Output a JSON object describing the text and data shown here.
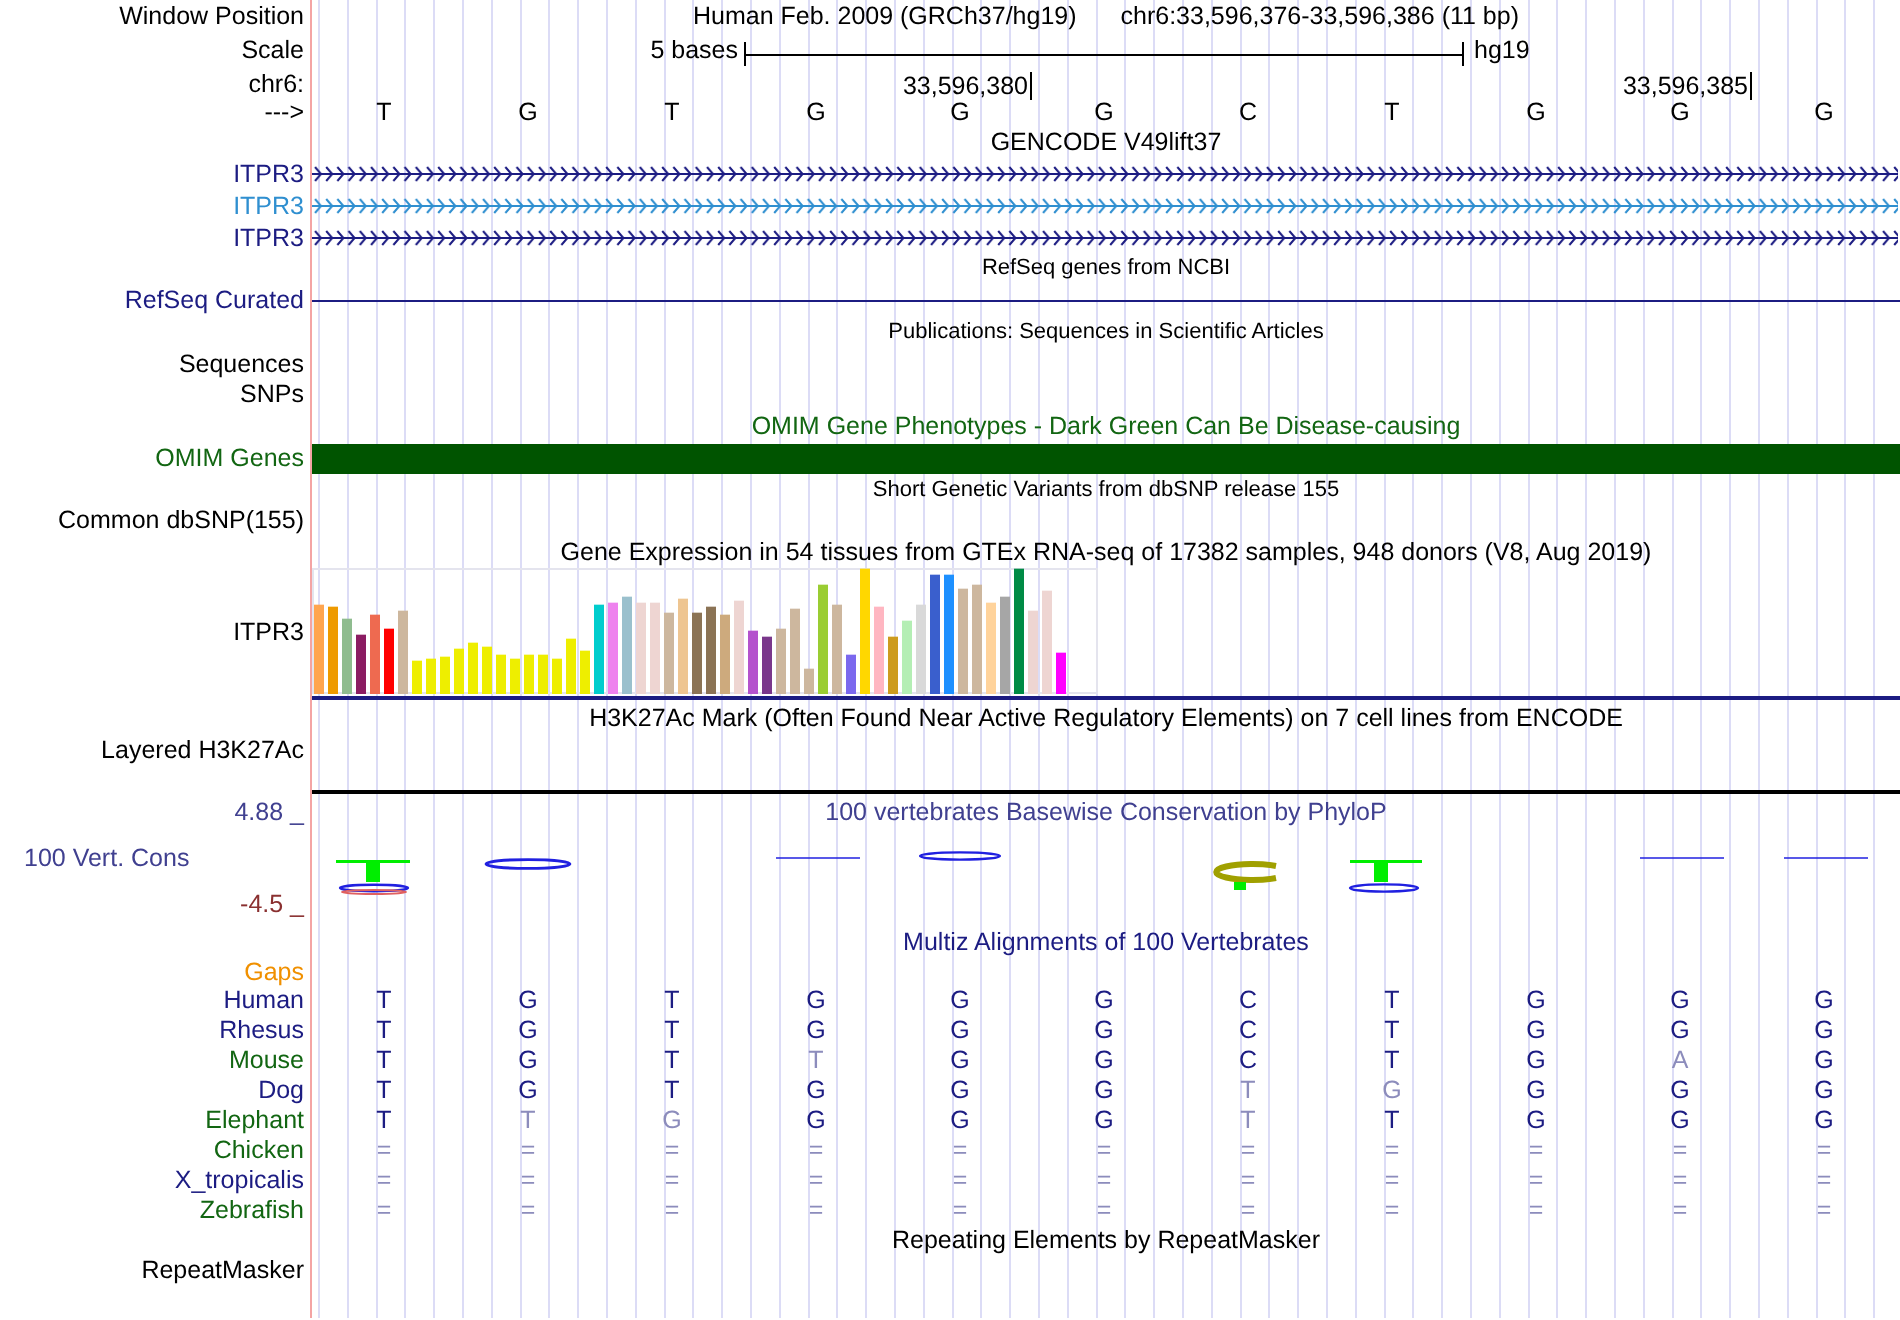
{
  "window_position": {
    "label": "Window Position",
    "assembly": "Human Feb. 2009 (GRCh37/hg19)",
    "range": "chr6:33,596,376-33,596,386 (11 bp)"
  },
  "scale": {
    "label": "Scale",
    "length": "5 bases",
    "assembly": "hg19"
  },
  "chromosome": {
    "label": "chr6:",
    "ticks": [
      "33,596,380",
      "33,596,385"
    ]
  },
  "strand": {
    "label": "--->",
    "bases": [
      "T",
      "G",
      "T",
      "G",
      "G",
      "G",
      "C",
      "T",
      "G",
      "G",
      "G"
    ]
  },
  "gencode": {
    "title": "GENCODE V49lift37",
    "genes": [
      {
        "name": "ITPR3",
        "color": "#1c1c82"
      },
      {
        "name": "ITPR3",
        "color": "#2f8fd0"
      },
      {
        "name": "ITPR3",
        "color": "#1c1c82"
      }
    ]
  },
  "refseq": {
    "title": "RefSeq genes from NCBI",
    "label": "RefSeq Curated"
  },
  "publications": {
    "title": "Publications: Sequences in Scientific Articles",
    "labels": [
      "Sequences",
      "SNPs"
    ]
  },
  "omim": {
    "title": "OMIM Gene Phenotypes - Dark Green Can Be Disease-causing",
    "label": "OMIM Genes"
  },
  "dbsnp": {
    "title": "Short Genetic Variants from dbSNP release 155",
    "label": "Common dbSNP(155)"
  },
  "gtex": {
    "title": "Gene Expression in 54 tissues from GTEx RNA-seq of 17382 samples, 948 donors (V8, Aug 2019)",
    "label": "ITPR3"
  },
  "h3k27ac": {
    "title": "H3K27Ac Mark (Often Found Near Active Regulatory Elements) on 7 cell lines from ENCODE",
    "label": "Layered H3K27Ac"
  },
  "phylop": {
    "title": "100 vertebrates Basewise Conservation by PhyloP",
    "label": "100 Vert. Cons",
    "max": "4.88 _",
    "min": "-4.5 _"
  },
  "multiz": {
    "title": "Multiz Alignments of 100 Vertebrates",
    "gaps_label": "Gaps",
    "species": [
      {
        "name": "Human",
        "color": "#1c1c82",
        "bases": [
          {
            "base": "T",
            "match": true
          },
          {
            "base": "G",
            "match": true
          },
          {
            "base": "T",
            "match": true
          },
          {
            "base": "G",
            "match": true
          },
          {
            "base": "G",
            "match": true
          },
          {
            "base": "G",
            "match": true
          },
          {
            "base": "C",
            "match": true
          },
          {
            "base": "T",
            "match": true
          },
          {
            "base": "G",
            "match": true
          },
          {
            "base": "G",
            "match": true
          },
          {
            "base": "G",
            "match": true
          }
        ]
      },
      {
        "name": "Rhesus",
        "color": "#1c1c82",
        "bases": [
          {
            "base": "T",
            "match": true
          },
          {
            "base": "G",
            "match": true
          },
          {
            "base": "T",
            "match": true
          },
          {
            "base": "G",
            "match": true
          },
          {
            "base": "G",
            "match": true
          },
          {
            "base": "G",
            "match": true
          },
          {
            "base": "C",
            "match": true
          },
          {
            "base": "T",
            "match": true
          },
          {
            "base": "G",
            "match": true
          },
          {
            "base": "G",
            "match": true
          },
          {
            "base": "G",
            "match": true
          }
        ]
      },
      {
        "name": "Mouse",
        "color": "#126612",
        "bases": [
          {
            "base": "T",
            "match": true
          },
          {
            "base": "G",
            "match": true
          },
          {
            "base": "T",
            "match": true
          },
          {
            "base": "T",
            "match": false
          },
          {
            "base": "G",
            "match": true
          },
          {
            "base": "G",
            "match": true
          },
          {
            "base": "C",
            "match": true
          },
          {
            "base": "T",
            "match": true
          },
          {
            "base": "G",
            "match": true
          },
          {
            "base": "A",
            "match": false
          },
          {
            "base": "G",
            "match": true
          }
        ]
      },
      {
        "name": "Dog",
        "color": "#1c1c82",
        "bases": [
          {
            "base": "T",
            "match": true
          },
          {
            "base": "G",
            "match": true
          },
          {
            "base": "T",
            "match": true
          },
          {
            "base": "G",
            "match": true
          },
          {
            "base": "G",
            "match": true
          },
          {
            "base": "G",
            "match": true
          },
          {
            "base": "T",
            "match": false
          },
          {
            "base": "G",
            "match": false
          },
          {
            "base": "G",
            "match": true
          },
          {
            "base": "G",
            "match": true
          },
          {
            "base": "G",
            "match": true
          }
        ]
      },
      {
        "name": "Elephant",
        "color": "#126612",
        "bases": [
          {
            "base": "T",
            "match": true
          },
          {
            "base": "T",
            "match": false
          },
          {
            "base": "G",
            "match": false
          },
          {
            "base": "G",
            "match": true
          },
          {
            "base": "G",
            "match": true
          },
          {
            "base": "G",
            "match": true
          },
          {
            "base": "T",
            "match": false
          },
          {
            "base": "T",
            "match": true
          },
          {
            "base": "G",
            "match": true
          },
          {
            "base": "G",
            "match": true
          },
          {
            "base": "G",
            "match": true
          }
        ]
      },
      {
        "name": "Chicken",
        "color": "#126612",
        "bases": [
          {
            "base": "=",
            "match": false
          },
          {
            "base": "=",
            "match": false
          },
          {
            "base": "=",
            "match": false
          },
          {
            "base": "=",
            "match": false
          },
          {
            "base": "=",
            "match": false
          },
          {
            "base": "=",
            "match": false
          },
          {
            "base": "=",
            "match": false
          },
          {
            "base": "=",
            "match": false
          },
          {
            "base": "=",
            "match": false
          },
          {
            "base": "=",
            "match": false
          },
          {
            "base": "=",
            "match": false
          }
        ]
      },
      {
        "name": "X_tropicalis",
        "color": "#1c1c82",
        "bases": [
          {
            "base": "=",
            "match": false
          },
          {
            "base": "=",
            "match": false
          },
          {
            "base": "=",
            "match": false
          },
          {
            "base": "=",
            "match": false
          },
          {
            "base": "=",
            "match": false
          },
          {
            "base": "=",
            "match": false
          },
          {
            "base": "=",
            "match": false
          },
          {
            "base": "=",
            "match": false
          },
          {
            "base": "=",
            "match": false
          },
          {
            "base": "=",
            "match": false
          },
          {
            "base": "=",
            "match": false
          }
        ]
      },
      {
        "name": "Zebrafish",
        "color": "#126612",
        "bases": [
          {
            "base": "=",
            "match": false
          },
          {
            "base": "=",
            "match": false
          },
          {
            "base": "=",
            "match": false
          },
          {
            "base": "=",
            "match": false
          },
          {
            "base": "=",
            "match": false
          },
          {
            "base": "=",
            "match": false
          },
          {
            "base": "=",
            "match": false
          },
          {
            "base": "=",
            "match": false
          },
          {
            "base": "=",
            "match": false
          },
          {
            "base": "=",
            "match": false
          },
          {
            "base": "=",
            "match": false
          }
        ]
      }
    ]
  },
  "repeatmasker": {
    "title": "Repeating Elements by RepeatMasker",
    "label": "RepeatMasker"
  }
}
